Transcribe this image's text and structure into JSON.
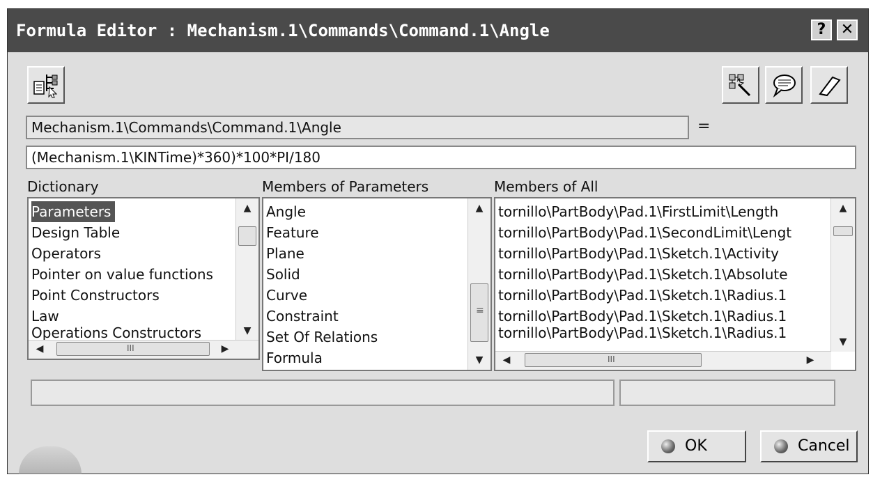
{
  "window": {
    "title": "Formula Editor : Mechanism.1\\Commands\\Command.1\\Angle",
    "help_glyph": "?",
    "close_glyph": "✕"
  },
  "toolbar": {
    "left_icon": "formula-tree-icon",
    "right_icons": [
      "pointer-wand-icon",
      "comment-bubble-icon",
      "eraser-icon"
    ]
  },
  "parameter_field": "Mechanism.1\\Commands\\Command.1\\Angle",
  "equals_sign": "=",
  "formula": "(Mechanism.1\\KINTime)*360)*100*PI/180",
  "dictionary": {
    "label": "Dictionary",
    "items": [
      "Parameters",
      "Design Table",
      "Operators",
      "Pointer on value functions",
      "Point Constructors",
      "Law",
      "Operations Constructors"
    ],
    "selected": "Parameters"
  },
  "members_of_parameters": {
    "label": "Members of Parameters",
    "items": [
      "Angle",
      "Feature",
      "Plane",
      "Solid",
      "Curve",
      "Constraint",
      "Set Of Relations",
      "Formula"
    ]
  },
  "members_of_all": {
    "label": "Members of All",
    "items": [
      "tornillo\\PartBody\\Pad.1\\FirstLimit\\Length",
      "tornillo\\PartBody\\Pad.1\\SecondLimit\\Lengt",
      "tornillo\\PartBody\\Pad.1\\Sketch.1\\Activity",
      "tornillo\\PartBody\\Pad.1\\Sketch.1\\Absolute",
      "tornillo\\PartBody\\Pad.1\\Sketch.1\\Radius.1",
      "tornillo\\PartBody\\Pad.1\\Sketch.1\\Radius.1",
      "tornillo\\PartBody\\Pad.1\\Sketch.1\\Radius.1"
    ]
  },
  "buttons": {
    "ok": "OK",
    "cancel": "Cancel"
  },
  "colors": {
    "title_bar": "#4a4a4a",
    "dialog_bg": "#dedede",
    "selection": "#555555"
  }
}
